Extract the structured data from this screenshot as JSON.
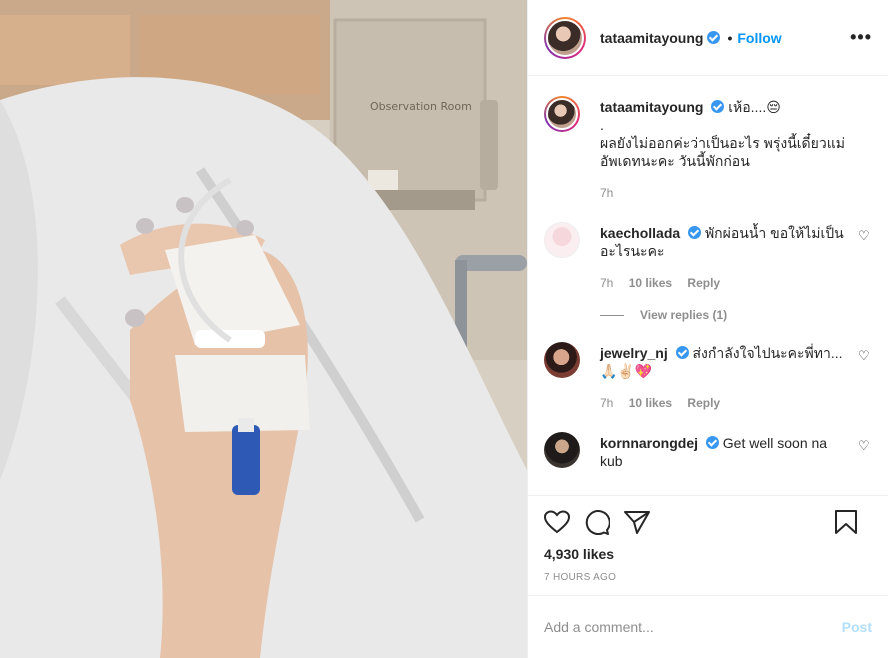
{
  "post": {
    "username": "tataamitayoung",
    "follow_label": "Follow",
    "more_label": "•••",
    "likes": "4,930 likes",
    "posted": "7 HOURS AGO"
  },
  "caption": {
    "username": "tataamitayoung",
    "text_line1": "เห้อ....😔",
    "text_line2": ".",
    "text_line3": "ผลยังไม่ออกค่ะว่าเป็นอะไร พรุ่งนี้เดี๋ยวแม่อัพเดทนะคะ วันนี้พักก่อน",
    "time": "7h"
  },
  "comments": [
    {
      "username": "kaechollada",
      "text": "พักผ่อนน้ำ ขอให้ไม่เป็นอะไรนะคะ",
      "time": "7h",
      "likes": "10 likes",
      "reply": "Reply"
    },
    {
      "username": "jewelry_nj",
      "text": "ส่งกำลังใจไปนะคะพี่ทา... 🙏🏻✌🏻💖",
      "time": "7h",
      "likes": "10 likes",
      "reply": "Reply"
    },
    {
      "username": "kornnarongdej",
      "text": "Get well soon na kub"
    }
  ],
  "view_replies": "View replies (1)",
  "add_comment": {
    "placeholder": "Add a comment...",
    "post_label": "Post"
  },
  "icons": [
    "heart-icon",
    "comment-icon",
    "share-icon",
    "bookmark-icon",
    "verified-icon"
  ],
  "colors": {
    "accent": "#0095f6",
    "post_disabled": "#b2dffc",
    "muted": "#8e8e8e",
    "verified": "#3897f0"
  }
}
